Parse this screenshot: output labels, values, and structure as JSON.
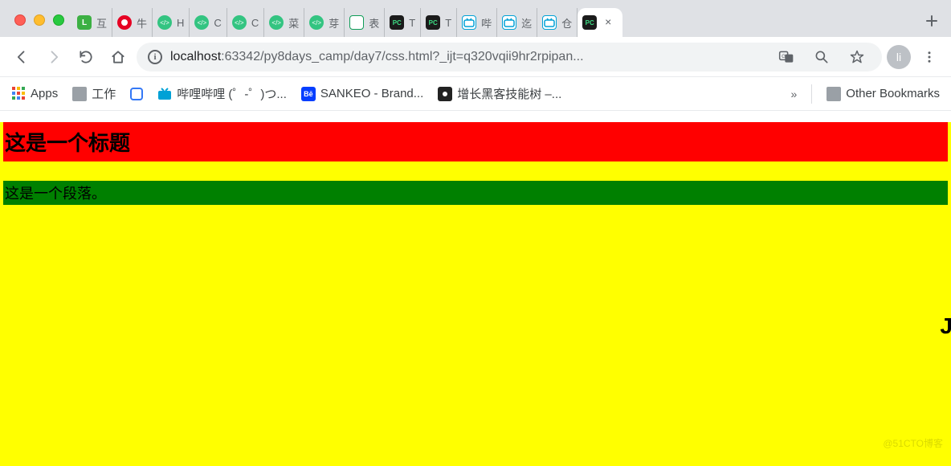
{
  "window": {
    "tabs": [
      {
        "icon": "green-L",
        "txt": "互"
      },
      {
        "icon": "red-music",
        "txt": "牛"
      },
      {
        "icon": "code",
        "txt": "H"
      },
      {
        "icon": "code",
        "txt": "C"
      },
      {
        "icon": "code",
        "txt": "C"
      },
      {
        "icon": "code",
        "txt": "菜"
      },
      {
        "icon": "code",
        "txt": "芽"
      },
      {
        "icon": "sheet",
        "txt": "表"
      },
      {
        "icon": "pc",
        "txt": "T"
      },
      {
        "icon": "pc",
        "txt": "T"
      },
      {
        "icon": "bili",
        "txt": "哔"
      },
      {
        "icon": "bili",
        "txt": "迄"
      },
      {
        "icon": "bili",
        "txt": "仓"
      }
    ],
    "active_tab_icon": "pc"
  },
  "toolbar": {
    "url_host": "localhost",
    "url_rest": ":63342/py8days_camp/day7/css.html?_ijt=q320vqii9hr2rpipan...",
    "avatar_text": "li"
  },
  "bookmarks": {
    "apps_label": "Apps",
    "items": [
      {
        "icon": "folder",
        "label": "工作"
      },
      {
        "icon": "near",
        "label": ""
      },
      {
        "icon": "bili2",
        "label": "哔哩哔哩 (゜-゜)つ..."
      },
      {
        "icon": "be",
        "label": "SANKEO - Brand..."
      },
      {
        "icon": "cube",
        "label": "增长黑客技能树 –..."
      }
    ],
    "overflow": "»",
    "other_label": "Other Bookmarks"
  },
  "page": {
    "heading": "这是一个标题",
    "paragraph": "这是一个段落。"
  },
  "watermark": "@51CTO博客",
  "side_letter": "J"
}
